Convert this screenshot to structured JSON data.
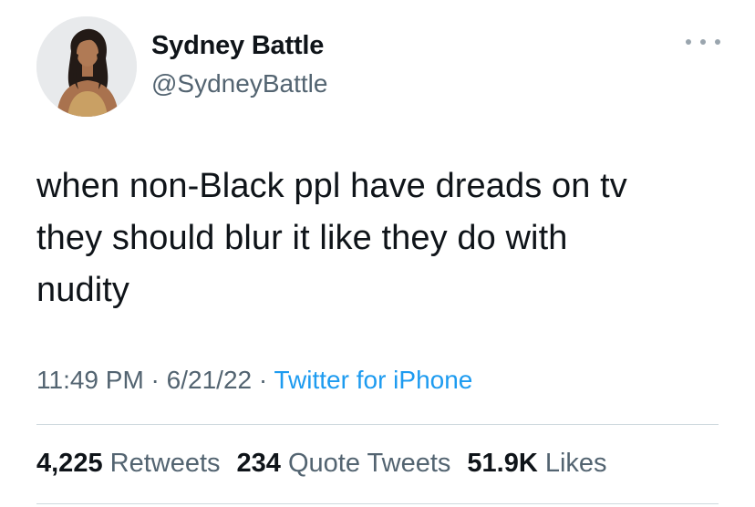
{
  "author": {
    "name": "Sydney Battle",
    "handle": "@SydneyBattle",
    "avatar_icon": "profile-photo"
  },
  "more_icon": "ellipsis-icon",
  "tweet": {
    "text": "when non-Black ppl have dreads on tv\nthey should blur it like they do with\nnudity"
  },
  "meta": {
    "time": "11:49 PM",
    "sep1": " · ",
    "date": "6/21/22",
    "sep2": " · ",
    "source": "Twitter for iPhone"
  },
  "stats": {
    "retweets_count": "4,225",
    "retweets_label": "Retweets",
    "quotes_count": "234",
    "quotes_label": "Quote Tweets",
    "likes_count": "51.9K",
    "likes_label": "Likes"
  },
  "colors": {
    "text": "#0f1419",
    "muted": "#536471",
    "link": "#1d9bf0",
    "divider": "#cfd9de"
  }
}
